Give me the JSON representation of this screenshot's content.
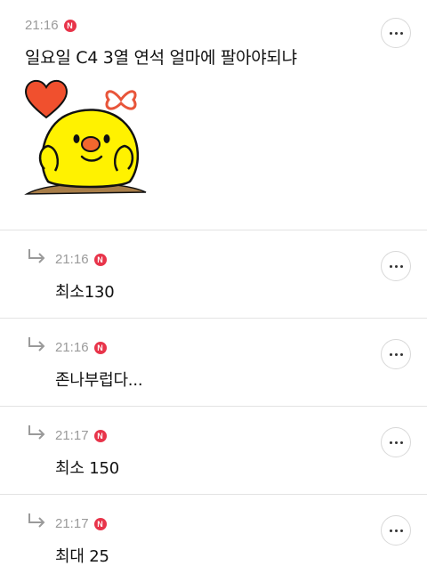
{
  "post": {
    "time": "21:16",
    "badge": "N",
    "title": "일요일 C4 3열 연석 얼마에 팔아야되냐",
    "sticker": "sally-chick-heart-sticker"
  },
  "replies": [
    {
      "time": "21:16",
      "badge": "N",
      "text": "최소130"
    },
    {
      "time": "21:16",
      "badge": "N",
      "text": "존나부럽다..."
    },
    {
      "time": "21:17",
      "badge": "N",
      "text": "최소 150"
    },
    {
      "time": "21:17",
      "badge": "N",
      "text": "최대 25"
    }
  ],
  "icons": {
    "more": "more-horizontal-icon",
    "reply": "reply-arrow-icon",
    "new": "new-badge"
  },
  "colors": {
    "badge": "#e8344a",
    "time": "#9a9a9a",
    "divider": "#e3e3e3",
    "chick": "#fff200",
    "heart": "#f0502e"
  }
}
